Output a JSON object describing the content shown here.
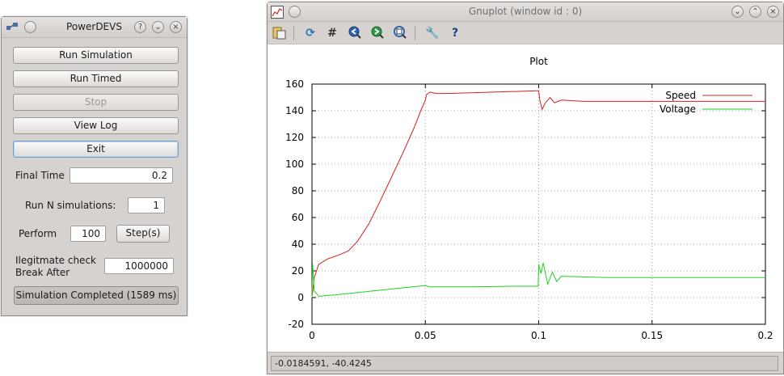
{
  "powerdevs": {
    "title": "PowerDEVS",
    "buttons": {
      "run_simulation": "Run Simulation",
      "run_timed": "Run Timed",
      "stop": "Stop",
      "view_log": "View Log",
      "exit": "Exit"
    },
    "final_time": {
      "label": "Final Time",
      "value": "0.2"
    },
    "run_n": {
      "label": "Run N simulations:",
      "value": "1"
    },
    "perform": {
      "label": "Perform",
      "value": "100",
      "button": "Step(s)"
    },
    "ilegitimate": {
      "label_line1": "Ilegitmate check",
      "label_line2": "Break After",
      "value": "1000000"
    },
    "status": "Simulation Completed (1589 ms)",
    "titlebar_buttons": {
      "help": "?",
      "minimize": "⌄",
      "close": "×"
    }
  },
  "gnuplot": {
    "title": "Gnuplot (window id : 0)",
    "toolbar_icons": [
      "copy-to-clipboard-icon",
      "replot-icon",
      "grid-icon",
      "zoom-previous-icon",
      "zoom-next-icon",
      "autoscale-icon",
      "settings-icon",
      "help-icon"
    ],
    "status_coords": "-0.0184591, -40.4245"
  },
  "chart_data": {
    "type": "line",
    "title": "Plot",
    "xlabel": "",
    "ylabel": "",
    "xlim": [
      0,
      0.2
    ],
    "ylim": [
      -20,
      160
    ],
    "xticks": [
      "0",
      "0.05",
      "0.1",
      "0.15",
      "0.2"
    ],
    "yticks": [
      "-20",
      "0",
      "20",
      "40",
      "60",
      "80",
      "100",
      "120",
      "140",
      "160"
    ],
    "grid": true,
    "legend_position": "top-right",
    "series": [
      {
        "name": "Speed",
        "color": "#d62020",
        "points": [
          [
            0,
            0
          ],
          [
            0.001,
            15
          ],
          [
            0.003,
            25
          ],
          [
            0.007,
            29
          ],
          [
            0.012,
            32
          ],
          [
            0.016,
            35
          ],
          [
            0.02,
            42
          ],
          [
            0.025,
            55
          ],
          [
            0.03,
            72
          ],
          [
            0.035,
            90
          ],
          [
            0.04,
            108
          ],
          [
            0.045,
            127
          ],
          [
            0.048,
            140
          ],
          [
            0.05,
            148
          ],
          [
            0.0505,
            152
          ],
          [
            0.052,
            154
          ],
          [
            0.055,
            153
          ],
          [
            0.06,
            153
          ],
          [
            0.07,
            153.5
          ],
          [
            0.08,
            154
          ],
          [
            0.09,
            154.5
          ],
          [
            0.099,
            155
          ],
          [
            0.1,
            155
          ],
          [
            0.1005,
            148
          ],
          [
            0.1015,
            141
          ],
          [
            0.103,
            146
          ],
          [
            0.105,
            150
          ],
          [
            0.107,
            146
          ],
          [
            0.11,
            148
          ],
          [
            0.12,
            147
          ],
          [
            0.15,
            147
          ],
          [
            0.2,
            147
          ]
        ]
      },
      {
        "name": "Voltage",
        "color": "#20d020",
        "points": [
          [
            0,
            0
          ],
          [
            0.0003,
            25
          ],
          [
            0.001,
            5
          ],
          [
            0.003,
            1
          ],
          [
            0.01,
            2
          ],
          [
            0.05,
            9
          ],
          [
            0.052,
            8
          ],
          [
            0.055,
            8
          ],
          [
            0.07,
            8
          ],
          [
            0.09,
            8.5
          ],
          [
            0.0998,
            8.5
          ],
          [
            0.1,
            25
          ],
          [
            0.101,
            18
          ],
          [
            0.102,
            26
          ],
          [
            0.104,
            10
          ],
          [
            0.106,
            19
          ],
          [
            0.108,
            12
          ],
          [
            0.11,
            16
          ],
          [
            0.13,
            15
          ],
          [
            0.15,
            15
          ],
          [
            0.2,
            15
          ]
        ]
      }
    ]
  }
}
